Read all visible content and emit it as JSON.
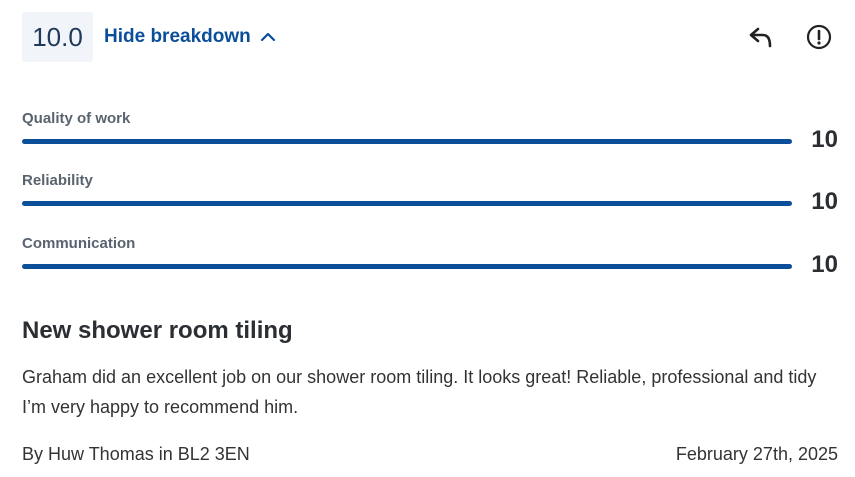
{
  "review": {
    "overall_score": "10.0",
    "toggle_label": "Hide breakdown",
    "toggle_icon": "chevron-up-icon",
    "action_icons": [
      "reply-icon",
      "report-icon"
    ],
    "breakdown": [
      {
        "label": "Quality of work",
        "score": "10",
        "fraction": 1.0
      },
      {
        "label": "Reliability",
        "score": "10",
        "fraction": 1.0
      },
      {
        "label": "Communication",
        "score": "10",
        "fraction": 1.0
      }
    ],
    "title": "New shower room tiling",
    "body": "Graham did an excellent job on our shower room tiling. It looks great! Reliable, professional and tidy I’m very happy to recommend him.",
    "byline": "By Huw Thomas in BL2 3EN",
    "date": "February 27th, 2025"
  },
  "colors": {
    "accent": "#0b4f9a",
    "score_box_bg": "#f1f4f8",
    "track": "#dfe5ec"
  }
}
